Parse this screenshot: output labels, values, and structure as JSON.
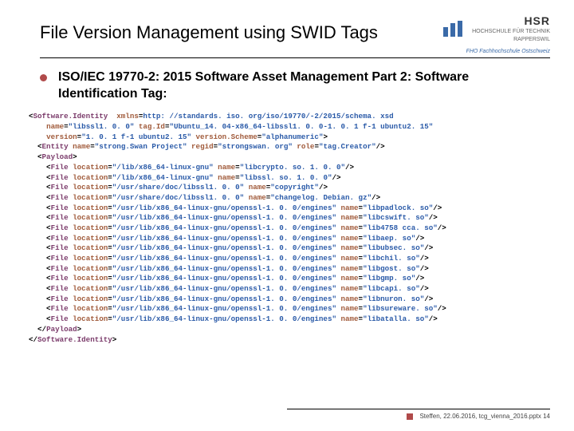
{
  "header": {
    "title": "File Version Management using SWID Tags",
    "logo_text": "HSR",
    "logo_sub1": "HOCHSCHULE FÜR TECHNIK",
    "logo_sub2": "RAPPERSWIL",
    "logo_sub3": "FHO Fachhochschule Ostschweiz"
  },
  "bullet": {
    "text": "ISO/IEC 19770-2: 2015 Software Asset Management Part 2: Software Identification Tag:"
  },
  "code": {
    "root_open": "Software.Identity",
    "root_xmlns_attr": "xmlns",
    "root_xmlns_val": "http: //standards. iso. org/iso/19770/-2/2015/schema. xsd",
    "root_name_attr": "name",
    "root_name_val": "\"libssl1. 0. 0\"",
    "root_tagid_attr": "tag.Id",
    "root_tagid_val": "\"Ubuntu_14. 04-x86_64-libssl1. 0. 0-1. 0. 1 f-1 ubuntu2. 15\"",
    "root_version_attr": "version",
    "root_version_val": "\"1. 0. 1 f-1 ubuntu2. 15\"",
    "root_vscheme_attr": "version.Scheme",
    "root_vscheme_val": "\"alphanumeric\"",
    "entity_tag": "Entity",
    "entity_name_attr": "name",
    "entity_name_val": "\"strong.Swan Project\"",
    "entity_regid_attr": "regid",
    "entity_regid_val": "\"strongswan. org\"",
    "entity_role_attr": "role",
    "entity_role_val": "\"tag.Creator\"",
    "payload_open": "Payload",
    "file_tag": "File",
    "loc_attr": "location",
    "name_attr": "name",
    "files": [
      {
        "loc": "\"/lib/x86_64-linux-gnu\"",
        "name": "\"libcrypto. so. 1. 0. 0\""
      },
      {
        "loc": "\"/lib/x86_64-linux-gnu\"",
        "name": "\"libssl. so. 1. 0. 0\""
      },
      {
        "loc": "\"/usr/share/doc/libssl1. 0. 0\"",
        "name": "\"copyright\""
      },
      {
        "loc": "\"/usr/share/doc/libssl1. 0. 0\"",
        "name": "\"changelog. Debian. gz\""
      },
      {
        "loc": "\"/usr/lib/x86_64-linux-gnu/openssl-1. 0. 0/engines\"",
        "name": "\"libpadlock. so\""
      },
      {
        "loc": "\"/usr/lib/x86_64-linux-gnu/openssl-1. 0. 0/engines\"",
        "name": "\"libcswift. so\""
      },
      {
        "loc": "\"/usr/lib/x86_64-linux-gnu/openssl-1. 0. 0/engines\"",
        "name": "\"lib4758 cca. so\""
      },
      {
        "loc": "\"/usr/lib/x86_64-linux-gnu/openssl-1. 0. 0/engines\"",
        "name": "\"libaep. so\""
      },
      {
        "loc": "\"/usr/lib/x86_64-linux-gnu/openssl-1. 0. 0/engines\"",
        "name": "\"libubsec. so\""
      },
      {
        "loc": "\"/usr/lib/x86_64-linux-gnu/openssl-1. 0. 0/engines\"",
        "name": "\"libchil. so\""
      },
      {
        "loc": "\"/usr/lib/x86_64-linux-gnu/openssl-1. 0. 0/engines\"",
        "name": "\"libgost. so\""
      },
      {
        "loc": "\"/usr/lib/x86_64-linux-gnu/openssl-1. 0. 0/engines\"",
        "name": "\"libgmp. so\""
      },
      {
        "loc": "\"/usr/lib/x86_64-linux-gnu/openssl-1. 0. 0/engines\"",
        "name": "\"libcapi. so\""
      },
      {
        "loc": "\"/usr/lib/x86_64-linux-gnu/openssl-1. 0. 0/engines\"",
        "name": "\"libnuron. so\""
      },
      {
        "loc": "\"/usr/lib/x86_64-linux-gnu/openssl-1. 0. 0/engines\"",
        "name": "\"libsureware. so\""
      },
      {
        "loc": "\"/usr/lib/x86_64-linux-gnu/openssl-1. 0. 0/engines\"",
        "name": "\"libatalla. so\""
      }
    ],
    "payload_close": "Payload",
    "root_close": "Software.Identity"
  },
  "footer": {
    "text": "Steffen, 22.06.2016, tcg_vienna_2016.pptx 14"
  }
}
